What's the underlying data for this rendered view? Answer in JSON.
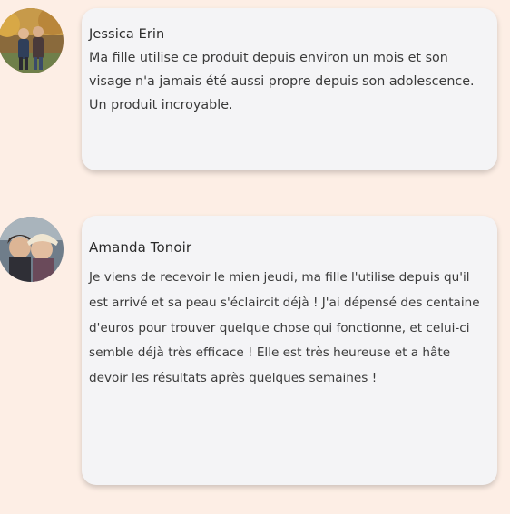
{
  "reviews": [
    {
      "name": "Jessica Erin",
      "text": "Ma fille utilise ce produit depuis environ un mois et son visage n'a jamais été aussi propre depuis son adolescence. Un produit incroyable.",
      "avatar_icon": "user-photo-two-people"
    },
    {
      "name": "Amanda Tonoir",
      "text": "Je viens de recevoir le mien jeudi, ma fille l'utilise depuis qu'il est arrivé et sa peau s'éclaircit déjà ! J'ai dépensé des centaine d'euros pour trouver quelque chose qui fonctionne, et celui-ci semble déjà très efficace ! Elle est très heureuse et a hâte devoir les résultats après quelques semaines !",
      "avatar_icon": "user-photo-selfie"
    }
  ],
  "colors": {
    "page_background": "#fdeee5",
    "card_background": "#f4f4f6",
    "text": "#3a3a3a"
  }
}
